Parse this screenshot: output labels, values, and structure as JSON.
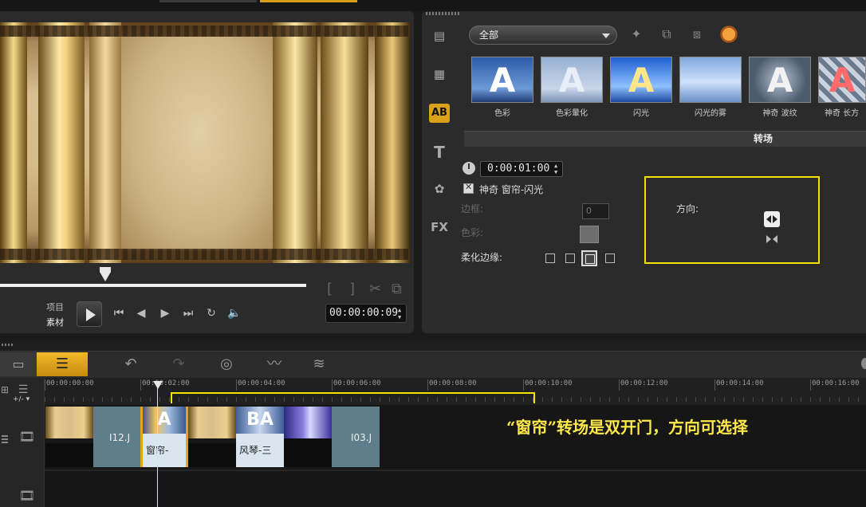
{
  "library": {
    "filter_label": "全部",
    "thumbnails": [
      {
        "label": "色彩",
        "letter": "A",
        "bg": "#3c69b0"
      },
      {
        "label": "色彩暈化",
        "letter": "A",
        "bg": "#9ab3d6"
      },
      {
        "label": "闪光",
        "letter": "A",
        "bg": "#2d6fd3"
      },
      {
        "label": "闪光的雾",
        "letter": "",
        "bg": "#8fb4e6"
      },
      {
        "label": "神奇 波纹",
        "letter": "A",
        "bg": "#5b6c80"
      },
      {
        "label": "神奇 长方",
        "letter": "A",
        "bg": "#4a5a6e"
      }
    ],
    "section_title": "转场"
  },
  "options": {
    "duration": "0:00:01:00",
    "transition_name": "神奇 窗帘-闪光",
    "border_label": "边框:",
    "border_value": "0",
    "color_label": "色彩:",
    "soften_label": "柔化边缘:",
    "direction_label": "方向:"
  },
  "player": {
    "mode_project": "项目",
    "mode_clip": "素材",
    "timecode": "00:00:00:09"
  },
  "timeline": {
    "ruler_labels": [
      "00:00:00:00",
      "00:00:02:00",
      "00:00:04:00",
      "00:00:06:00",
      "00:00:08:00",
      "00:00:10:00",
      "00:00:12:00",
      "00:00:14:00",
      "00:00:16:00"
    ],
    "clips": {
      "clip1_label": "I12.J",
      "trans1_label": "窗帘-",
      "trans1_letters": "A",
      "trans2_label": "风琴-三",
      "trans2_letters": "BA",
      "clip3_label": "I03.J"
    },
    "zoom_label": "+/- ▾"
  },
  "annotation": "“窗帘”转场是双开门，方向可选择",
  "colors": {
    "accent": "#d9a21a",
    "highlight_yellow": "#f2e200",
    "annotation_text": "#ffe94a"
  }
}
